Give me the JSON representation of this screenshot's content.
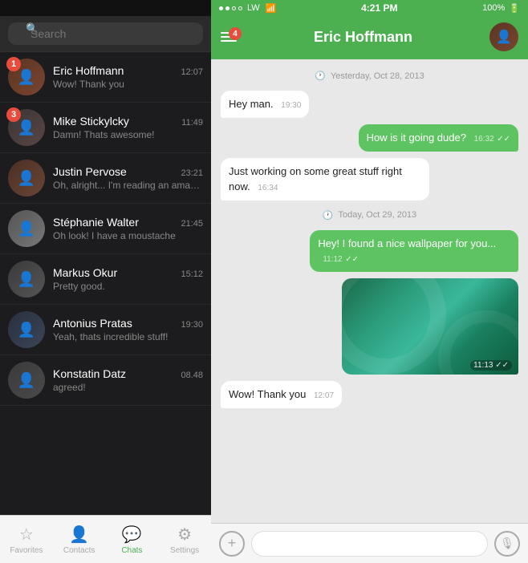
{
  "statusBar": {
    "signal": "●●○○",
    "carrier": "LW",
    "wifi": "WiFi",
    "time": "4:21 PM",
    "battery": "100%"
  },
  "search": {
    "placeholder": "Search"
  },
  "chats": [
    {
      "id": 1,
      "name": "Eric Hoffmann",
      "time": "12:07",
      "preview": "Wow! Thank you",
      "badge": null,
      "avatar_class": "av-eric"
    },
    {
      "id": 2,
      "name": "Mike Stickylcky",
      "time": "11:49",
      "preview": "Damn! Thats awesome!",
      "badge": "3",
      "avatar_class": "av-mike"
    },
    {
      "id": 3,
      "name": "Justin Pervose",
      "time": "23:21",
      "preview": "Oh, alright... I'm reading an amazing article at...",
      "badge": null,
      "avatar_class": "av-justin"
    },
    {
      "id": 4,
      "name": "Stéphanie Walter",
      "time": "21:45",
      "preview": "Oh look! I have a moustache",
      "badge": null,
      "avatar_class": "av-stephanie"
    },
    {
      "id": 5,
      "name": "Markus Okur",
      "time": "15:12",
      "preview": "Pretty good.",
      "badge": null,
      "avatar_class": "av-markus"
    },
    {
      "id": 6,
      "name": "Antonius Pratas",
      "time": "19:30",
      "preview": "Yeah, thats incredible stuff!",
      "badge": null,
      "avatar_class": "av-antonius"
    },
    {
      "id": 7,
      "name": "Konstatin Datz",
      "time": "08.48",
      "preview": "agreed!",
      "badge": null,
      "avatar_class": "av-konstatin"
    }
  ],
  "tabs": [
    {
      "id": "favorites",
      "label": "Favorites",
      "icon": "☆",
      "active": false
    },
    {
      "id": "contacts",
      "label": "Contacts",
      "icon": "👤",
      "active": false
    },
    {
      "id": "chats",
      "label": "Chats",
      "icon": "💬",
      "active": true
    },
    {
      "id": "settings",
      "label": "Settings",
      "icon": "⚙",
      "active": false
    }
  ],
  "conversation": {
    "name": "Eric Hoffmann",
    "headerBadge": "4",
    "dateSeparator1": "Yesterday, Oct 28, 2013",
    "dateSeparator2": "Today, Oct 29, 2013",
    "messages": [
      {
        "id": 1,
        "type": "incoming",
        "text": "Hey man.",
        "time": "19:30",
        "checks": ""
      },
      {
        "id": 2,
        "type": "outgoing",
        "text": "How is it going dude?",
        "time": "16:32",
        "checks": "✓✓"
      },
      {
        "id": 3,
        "type": "incoming",
        "text": "Just working on some great stuff right now.",
        "time": "16:34",
        "checks": ""
      },
      {
        "id": 4,
        "type": "outgoing",
        "text": "Hey! I found a nice wallpaper for you...",
        "time": "11:12",
        "checks": "✓✓"
      },
      {
        "id": 5,
        "type": "outgoing-image",
        "time": "11:13",
        "checks": "✓✓"
      },
      {
        "id": 6,
        "type": "incoming",
        "text": "Wow! Thank you",
        "time": "12:07",
        "checks": ""
      }
    ]
  },
  "bottomBar": {
    "placeholder": "",
    "plusLabel": "+",
    "micLabel": "🎙"
  }
}
